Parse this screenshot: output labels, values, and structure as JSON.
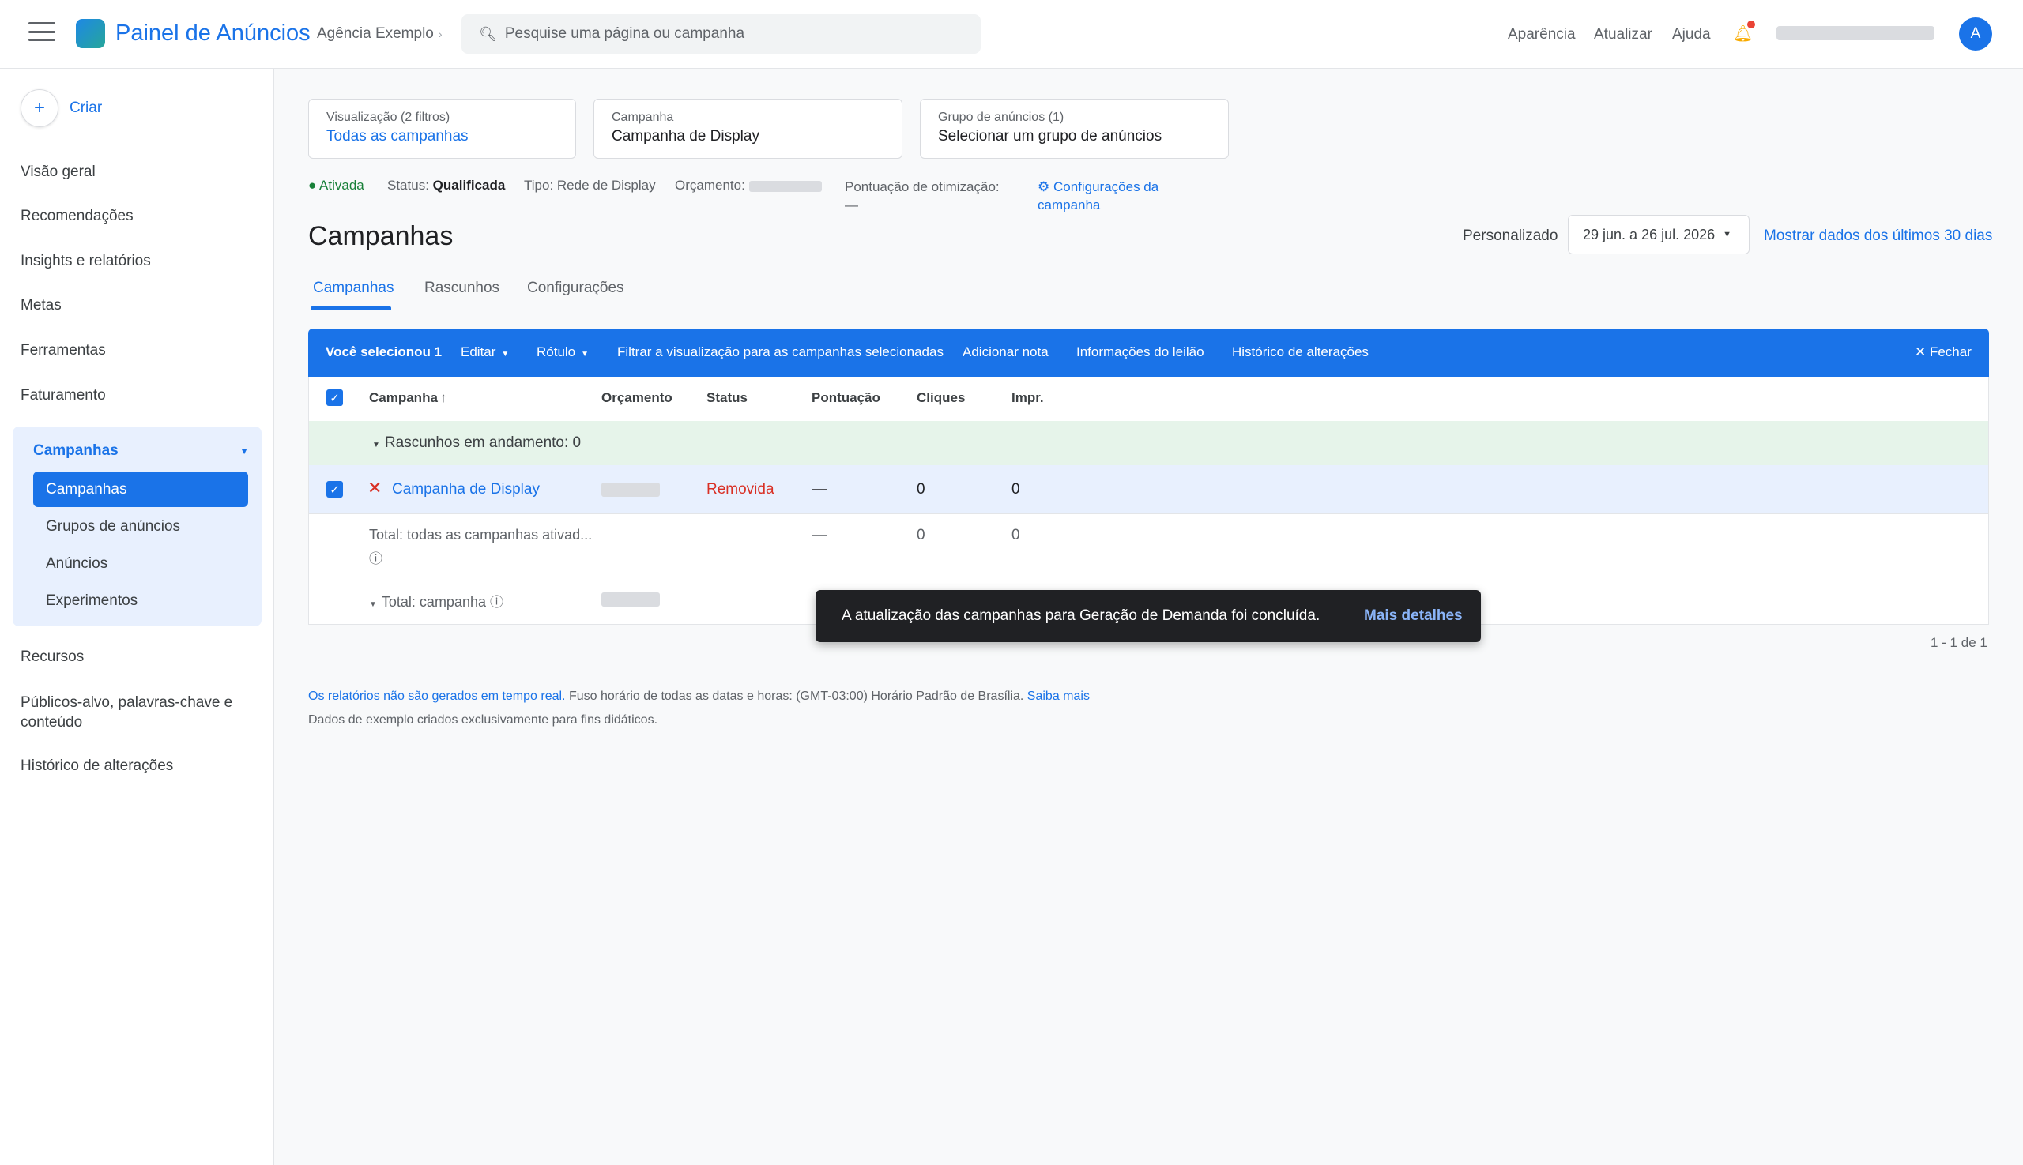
{
  "header": {
    "brand": "Painel de Anúncios",
    "account": "Agência Exemplo",
    "search_placeholder": "Pesquise uma página ou campanha",
    "links": [
      "Aparência",
      "Atualizar",
      "Ajuda"
    ],
    "avatar_letter": "A"
  },
  "sidebar": {
    "create": "Criar",
    "items": [
      "Visão geral",
      "Recomendações",
      "Insights e relatórios",
      "Metas",
      "Ferramentas",
      "Faturamento"
    ],
    "group": {
      "label": "Campanhas",
      "active": "Campanhas",
      "subitems": [
        "Grupos de anúncios",
        "Anúncios",
        "Experimentos"
      ]
    },
    "bottom_items": [
      "Recursos",
      "Públicos-alvo, palavras-chave e conteúdo",
      "Histórico de alterações"
    ]
  },
  "filters": {
    "view": {
      "label": "Visualização (2 filtros)",
      "value": "Todas as campanhas"
    },
    "campaign": {
      "label": "Campanha",
      "value": "Campanha de Display"
    },
    "adgroup": {
      "label": "Grupo de anúncios (1)",
      "value": "Selecionar um grupo de anúncios"
    }
  },
  "status": {
    "enabled": "● Ativada",
    "status_label": "Status:",
    "status_value": "Qualificada",
    "type": "Tipo: Rede de Display",
    "budget_label": "Orçamento:",
    "optimization_label": "Pontuação de otimização:",
    "optimization_value": "—",
    "settings_link": "⚙ Configurações da campanha"
  },
  "page": {
    "title": "Campanhas",
    "range_label": "Personalizado",
    "range_value": "29 jun. a 26 jul. 2026",
    "last30": "Mostrar dados dos últimos 30 dias"
  },
  "tabs": [
    "Campanhas",
    "Rascunhos",
    "Configurações"
  ],
  "actionbar": {
    "selected": "Você selecionou 1",
    "edit": "Editar",
    "label": "Rótulo",
    "filter": "Filtrar a visualização para as campanhas selecionadas",
    "note": "Adicionar nota",
    "auction": "Informações do leilão",
    "history": "Histórico de alterações",
    "close": "✕ Fechar"
  },
  "table": {
    "headers": {
      "campaign": "Campanha",
      "sort": "↑",
      "budget": "Orçamento",
      "status": "Status",
      "score": "Pontuação",
      "clicks": "Cliques",
      "impr": "Impr."
    },
    "drafts": "Rascunhos em andamento: 0",
    "row": {
      "name": "Campanha de Display",
      "status": "Removida",
      "score": "—",
      "clicks": "0",
      "impr": "0"
    },
    "total_all": {
      "label": "Total: todas as campanhas ativad...",
      "score": "—",
      "clicks": "0",
      "impr": "0"
    },
    "total_campaign": {
      "label": "Total: campanha"
    }
  },
  "pager": "1 - 1 de 1",
  "footer": {
    "link1": "Os relatórios não são gerados em tempo real.",
    "text": " Fuso horário de todas as datas e horas: (GMT-03:00) Horário Padrão de Brasília. ",
    "link2": "Saiba mais",
    "line2": "Dados de exemplo criados exclusivamente para fins didáticos."
  },
  "toast": {
    "message": "A atualização das campanhas para Geração de Demanda foi concluída.",
    "action": "Mais detalhes"
  }
}
